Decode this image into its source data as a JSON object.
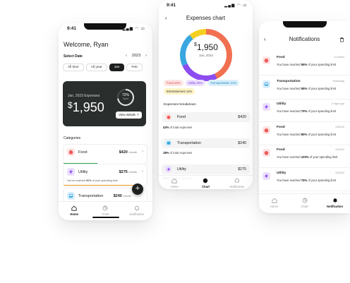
{
  "colors": {
    "food": "#f05a5a",
    "utility": "#8b4cf0",
    "transportation": "#3aa7e0",
    "entertainment": "#f5c518",
    "dark": "#1d1f1e"
  },
  "phone1": {
    "time": "9:41",
    "welcome": "Welcome, Ryan",
    "select_date": "Select Date",
    "year": "2023",
    "chips": [
      "All time",
      "All year",
      "Jan",
      "Feb"
    ],
    "hero": {
      "label": "Jan, 2023 Expenses",
      "currency": "$",
      "amount": "1,950",
      "percent": "72%",
      "percent_sub": "Spent",
      "view_details": "View details"
    },
    "categories_label": "Categories",
    "categories": [
      {
        "name": "Food",
        "amount": "$420",
        "per": "/month",
        "icon": "food-icon"
      },
      {
        "name": "Utility",
        "amount": "$275",
        "per": "/month",
        "note_pre": "You've reached ",
        "note_pct": "90%",
        "note_post": " of your spending limit",
        "icon": "lightning-icon"
      },
      {
        "name": "Transportation",
        "amount": "$240",
        "per": "/month",
        "note_pre": "You've reached ",
        "note_pct": "60%",
        "note_post": " of your spending limit",
        "icon": "bus-icon"
      }
    ],
    "tabs": [
      "Home",
      "Chart",
      "Notification"
    ]
  },
  "phone2": {
    "title": "Expenses chart",
    "donut_currency": "$",
    "donut_amount": "1,950",
    "donut_date": "Jan, 2023",
    "legend": [
      {
        "label": "Food 43%",
        "key": "food"
      },
      {
        "label": "Utility 25%",
        "key": "utility"
      },
      {
        "label": "Transportation 21%",
        "key": "transportation"
      },
      {
        "label": "Entertainment 11%",
        "key": "entertainment"
      }
    ],
    "breakdown_label": "Expenses breakdown",
    "breakdown": [
      {
        "name": "Food",
        "amount": "$420",
        "note_pct": "43%",
        "note_post": " of total expenses"
      },
      {
        "name": "Transportation",
        "amount": "$240",
        "note_pct": "18%",
        "note_post": " of total expenses"
      },
      {
        "name": "Utility",
        "amount": "$275",
        "note_pct": "25%",
        "note_post": " of total expenses"
      }
    ],
    "tabs": [
      "Home",
      "Chart",
      "Notification"
    ]
  },
  "phone3": {
    "time": "9:41",
    "title": "Notifications",
    "items": [
      {
        "title": "Food",
        "time": "11:56am",
        "pre": "You have reached ",
        "pct": "95%",
        "post": " of your spending limit",
        "key": "food"
      },
      {
        "title": "Transportation",
        "time": "Yesterday",
        "pre": "You have reached ",
        "pct": "95%",
        "post": " of your spending limit",
        "key": "transportation"
      },
      {
        "title": "Utility",
        "time": "3 days ago",
        "pre": "You have reached ",
        "pct": "70%",
        "post": " of your spending limit",
        "key": "utility"
      },
      {
        "title": "Food",
        "time": "03/6/23",
        "pre": "You have reached ",
        "pct": "80%",
        "post": " of your spending limit",
        "key": "food"
      },
      {
        "title": "Food",
        "time": "03/5/22",
        "pre": "You have reached ",
        "pct": "100%",
        "post": " of your spending limit",
        "key": "food"
      },
      {
        "title": "Utility",
        "time": "03/5/22",
        "pre": "You have reached ",
        "pct": "75%",
        "post": " of your spending limit",
        "key": "utility"
      }
    ],
    "tabs": [
      "Home",
      "Chart",
      "Notification"
    ]
  }
}
